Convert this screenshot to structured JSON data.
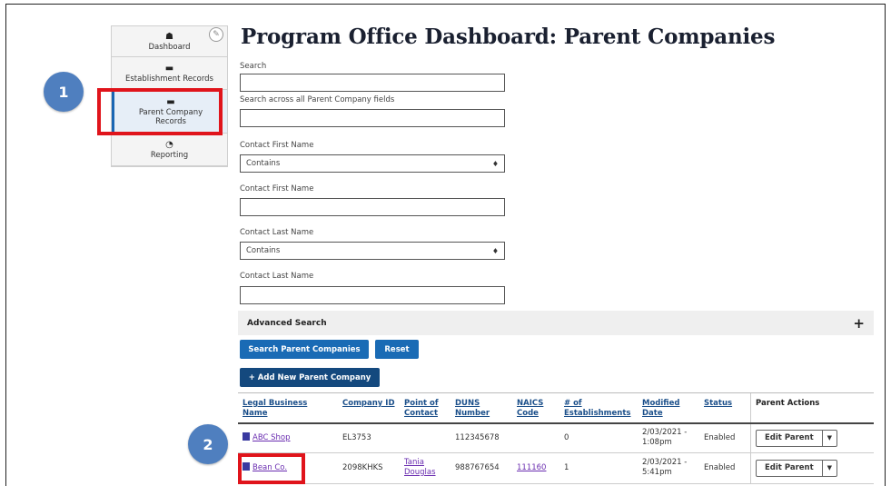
{
  "sidebar": {
    "items": [
      {
        "label": "Dashboard",
        "icon": "home-icon"
      },
      {
        "label": "Establishment Records",
        "icon": "folder-icon"
      },
      {
        "label": "Parent Company Records",
        "icon": "folder-icon",
        "active": true
      },
      {
        "label": "Reporting",
        "icon": "pie-chart-icon"
      }
    ]
  },
  "page": {
    "title": "Program Office Dashboard: Parent Companies"
  },
  "form": {
    "search_label": "Search",
    "search_all_label": "Search across all Parent Company fields",
    "contact_first_select_label": "Contact First Name",
    "contact_first_select_value": "Contains",
    "contact_first_input_label": "Contact First Name",
    "contact_last_select_label": "Contact Last Name",
    "contact_last_select_value": "Contains",
    "contact_last_input_label": "Contact Last Name",
    "advanced_search": "Advanced Search",
    "search_button": "Search Parent Companies",
    "reset_button": "Reset",
    "add_button": "+ Add New Parent Company"
  },
  "table": {
    "headers": [
      "Legal Business Name",
      "Company ID",
      "Point of Contact",
      "DUNS Number",
      "NAICS Code",
      "# of Establishments",
      "Modified Date",
      "Status",
      "Parent Actions"
    ],
    "rows": [
      {
        "name": "ABC Shop",
        "company_id": "EL3753",
        "contact": "",
        "duns": "112345678",
        "naics": "",
        "establishments": "0",
        "modified": "2/03/2021 - 1:08pm",
        "status": "Enabled",
        "action": "Edit Parent"
      },
      {
        "name": "Bean Co.",
        "company_id": "2098KHKS",
        "contact": "Tania Douglas",
        "duns": "988767654",
        "naics": "111160",
        "establishments": "1",
        "modified": "2/03/2021 - 5:41pm",
        "status": "Enabled",
        "action": "Edit Parent"
      }
    ]
  },
  "annotations": {
    "step1": "1",
    "step2": "2"
  },
  "colors": {
    "highlight": "#e0141b",
    "badge": "#4f7fbf",
    "primary": "#1a6bb5"
  }
}
